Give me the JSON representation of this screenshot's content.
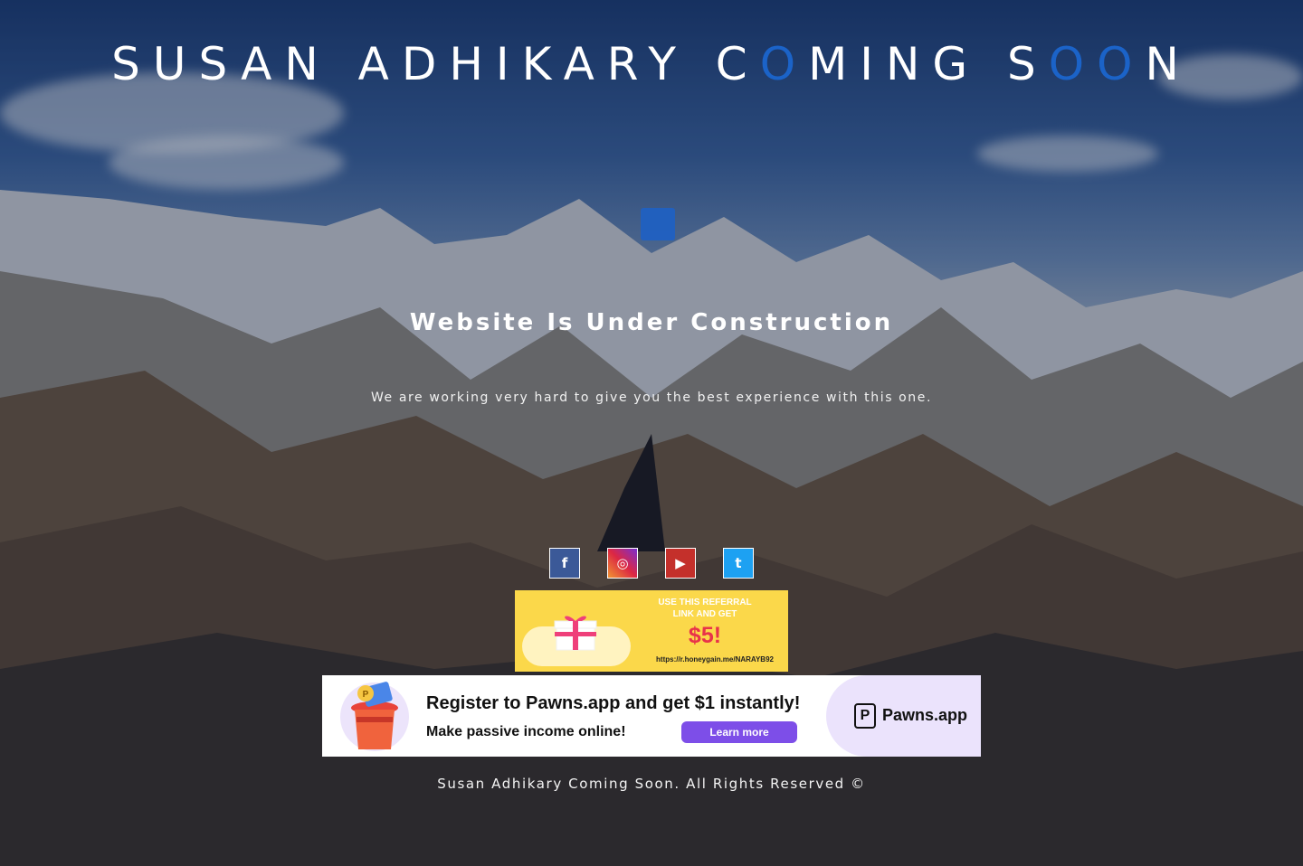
{
  "page": {
    "title_prefix": "SUSAN ADHIKARY ",
    "title_c": "C",
    "title_o1": "O",
    "title_ming": "MING S",
    "title_o2": "O",
    "title_o3": "O",
    "title_n": "N",
    "headline": "Website Is Under Construction",
    "tagline": "We are working very hard to give you the best experience with this one.",
    "footer": "Susan Adhikary Coming Soon. All Rights Reserved ©"
  },
  "social": [
    {
      "name": "facebook",
      "glyph": "f"
    },
    {
      "name": "instagram",
      "glyph": "◎"
    },
    {
      "name": "youtube",
      "glyph": "▶"
    },
    {
      "name": "twitter",
      "glyph": "t"
    }
  ],
  "honeygain_ad": {
    "line1": "USE THIS REFERRAL",
    "line2": "LINK AND GET",
    "amount": "$5!",
    "link": "https://r.honeygain.me/NARAYB92"
  },
  "pawns_ad": {
    "headline": "Register to Pawns.app and get $1 instantly!",
    "subline": "Make passive income online!",
    "button": "Learn more",
    "logo_mark": "P",
    "logo_text": "Pawns.app"
  },
  "colors": {
    "accent": "#1b63c8",
    "facebook": "#3b5998",
    "youtube": "#c4302b",
    "twitter": "#1da1f2",
    "honeygain_yellow": "#fbd84a",
    "pawns_purple": "#7d4ee8"
  }
}
